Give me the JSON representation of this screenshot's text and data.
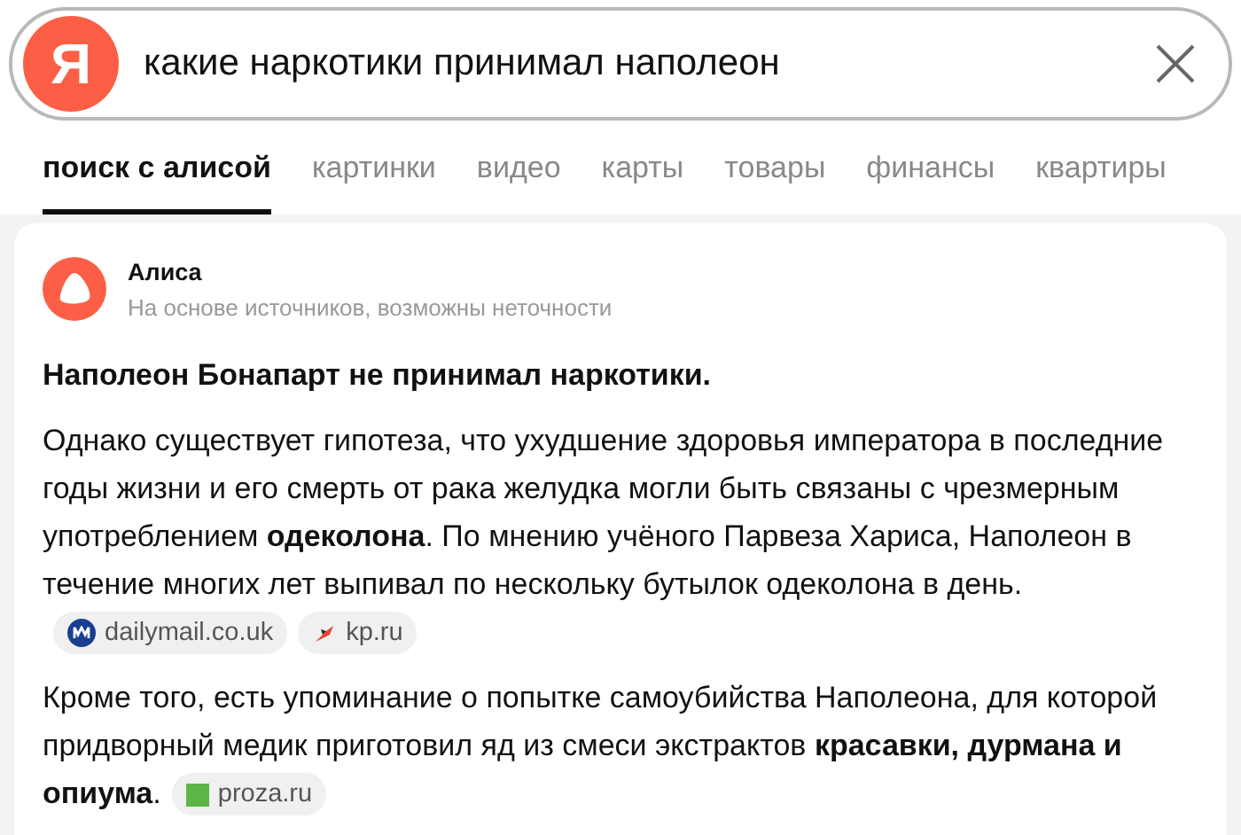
{
  "search": {
    "logo": "Я",
    "query": "какие наркотики принимал наполеон"
  },
  "tabs": [
    {
      "label": "поиск с алисой",
      "selected": true
    },
    {
      "label": "картинки",
      "selected": false
    },
    {
      "label": "видео",
      "selected": false
    },
    {
      "label": "карты",
      "selected": false
    },
    {
      "label": "товары",
      "selected": false
    },
    {
      "label": "финансы",
      "selected": false
    },
    {
      "label": "квартиры",
      "selected": false
    }
  ],
  "answer": {
    "author": "Алиса",
    "note": "На основе источников, возможны неточности",
    "headline": "Наполеон Бонапарт не принимал наркотики.",
    "paragraphs": [
      {
        "text": "Однако существует гипотеза, что ухудшение здоровья императора в последние годы жизни и его смерть от рака желудка могли быть связаны с чрезмерным употреблением **одеколона**. По мнению учёного Парвеза Хариса, Наполеон в течение многих лет выпивал по нескольку бутылок одеколона в день.",
        "sources": [
          {
            "label": "dailymail.co.uk",
            "kind": "mail"
          },
          {
            "label": "kp.ru",
            "kind": "bird"
          }
        ]
      },
      {
        "text": "Кроме того, есть упоминание о попытке самоубийства Наполеона, для которой придворный медик приготовил яд из смеси экстрактов **красавки, дурмана и опиума**.",
        "sources": [
          {
            "label": "proza.ru",
            "kind": "square"
          }
        ]
      }
    ]
  }
}
